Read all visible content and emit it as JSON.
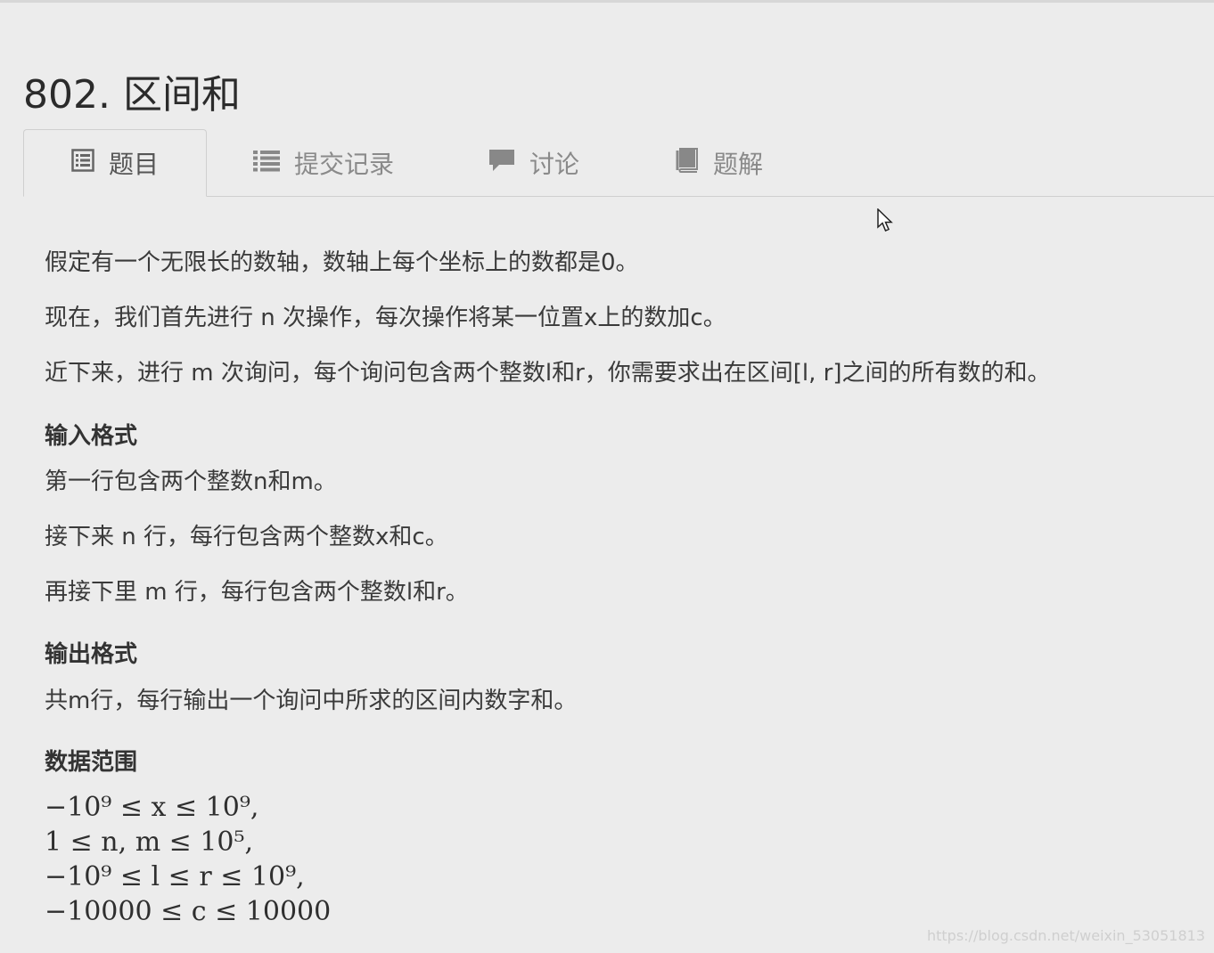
{
  "problem": {
    "title": "802. 区间和"
  },
  "tabs": [
    {
      "label": "题目",
      "icon": "document-list-icon",
      "active": true
    },
    {
      "label": "提交记录",
      "icon": "list-icon",
      "active": false
    },
    {
      "label": "讨论",
      "icon": "comment-icon",
      "active": false
    },
    {
      "label": "题解",
      "icon": "book-icon",
      "active": false
    }
  ],
  "description": {
    "p1": "假定有一个无限长的数轴，数轴上每个坐标上的数都是0。",
    "p2": "现在，我们首先进行 n 次操作，每次操作将某一位置x上的数加c。",
    "p3": "近下来，进行 m 次询问，每个询问包含两个整数l和r，你需要求出在区间[l, r]之间的所有数的和。"
  },
  "input_format": {
    "heading": "输入格式",
    "l1": "第一行包含两个整数n和m。",
    "l2": "接下来 n 行，每行包含两个整数x和c。",
    "l3": "再接下里 m 行，每行包含两个整数l和r。"
  },
  "output_format": {
    "heading": "输出格式",
    "l1": "共m行，每行输出一个询问中所求的区间内数字和。"
  },
  "data_range": {
    "heading": "数据范围",
    "lines": [
      "−10⁹ ≤ x ≤ 10⁹,",
      "1 ≤ n, m ≤ 10⁵,",
      "−10⁹ ≤ l ≤ r ≤ 10⁹,",
      "−10000 ≤ c ≤ 10000"
    ]
  },
  "watermark": "https://blog.csdn.net/weixin_53051813"
}
